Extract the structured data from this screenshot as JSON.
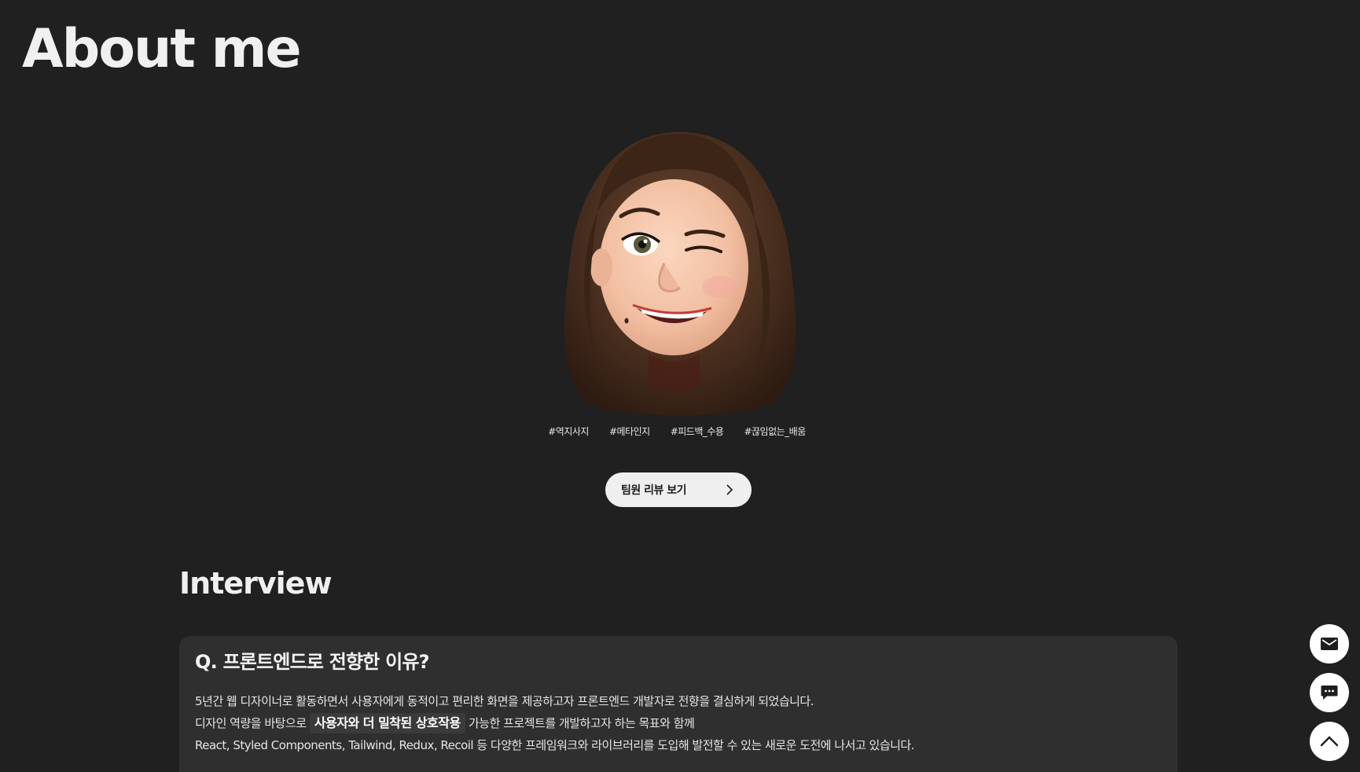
{
  "about": {
    "title": "About me",
    "avatar_alt": "memoji-avatar",
    "hashtags": [
      "#역지사지",
      "#메타인지",
      "#피드백_수용",
      "#끊임없는_배움"
    ],
    "review_button_label": "팀원 리뷰 보기"
  },
  "interview": {
    "title": "Interview",
    "question": "Q. 프론트엔드로 전향한 이유?",
    "answer_line1": "5년간 웹 디자이너로 활동하면서 사용자에게 동적이고 편리한 화면을 제공하고자 프론트엔드 개발자로 전향을 결심하게 되었습니다.",
    "answer_line2_before": "디자인 역량을 바탕으로",
    "answer_line2_highlight": "사용자와 더 밀착된 상호작용",
    "answer_line2_after": "가능한 프로젝트를 개발하고자 하는 목표와 함께",
    "answer_line3": "React, Styled Components, Tailwind, Redux, Recoil 등 다양한 프레임워크와 라이브러리를 도입해 발전할 수 있는 새로운 도전에 나서고 있습니다."
  },
  "floating": {
    "icons": [
      "mail-icon",
      "chat-icon",
      "chevron-up-icon"
    ]
  },
  "colors": {
    "background": "#202020",
    "card": "#2f2f2f",
    "button": "#efefef"
  }
}
